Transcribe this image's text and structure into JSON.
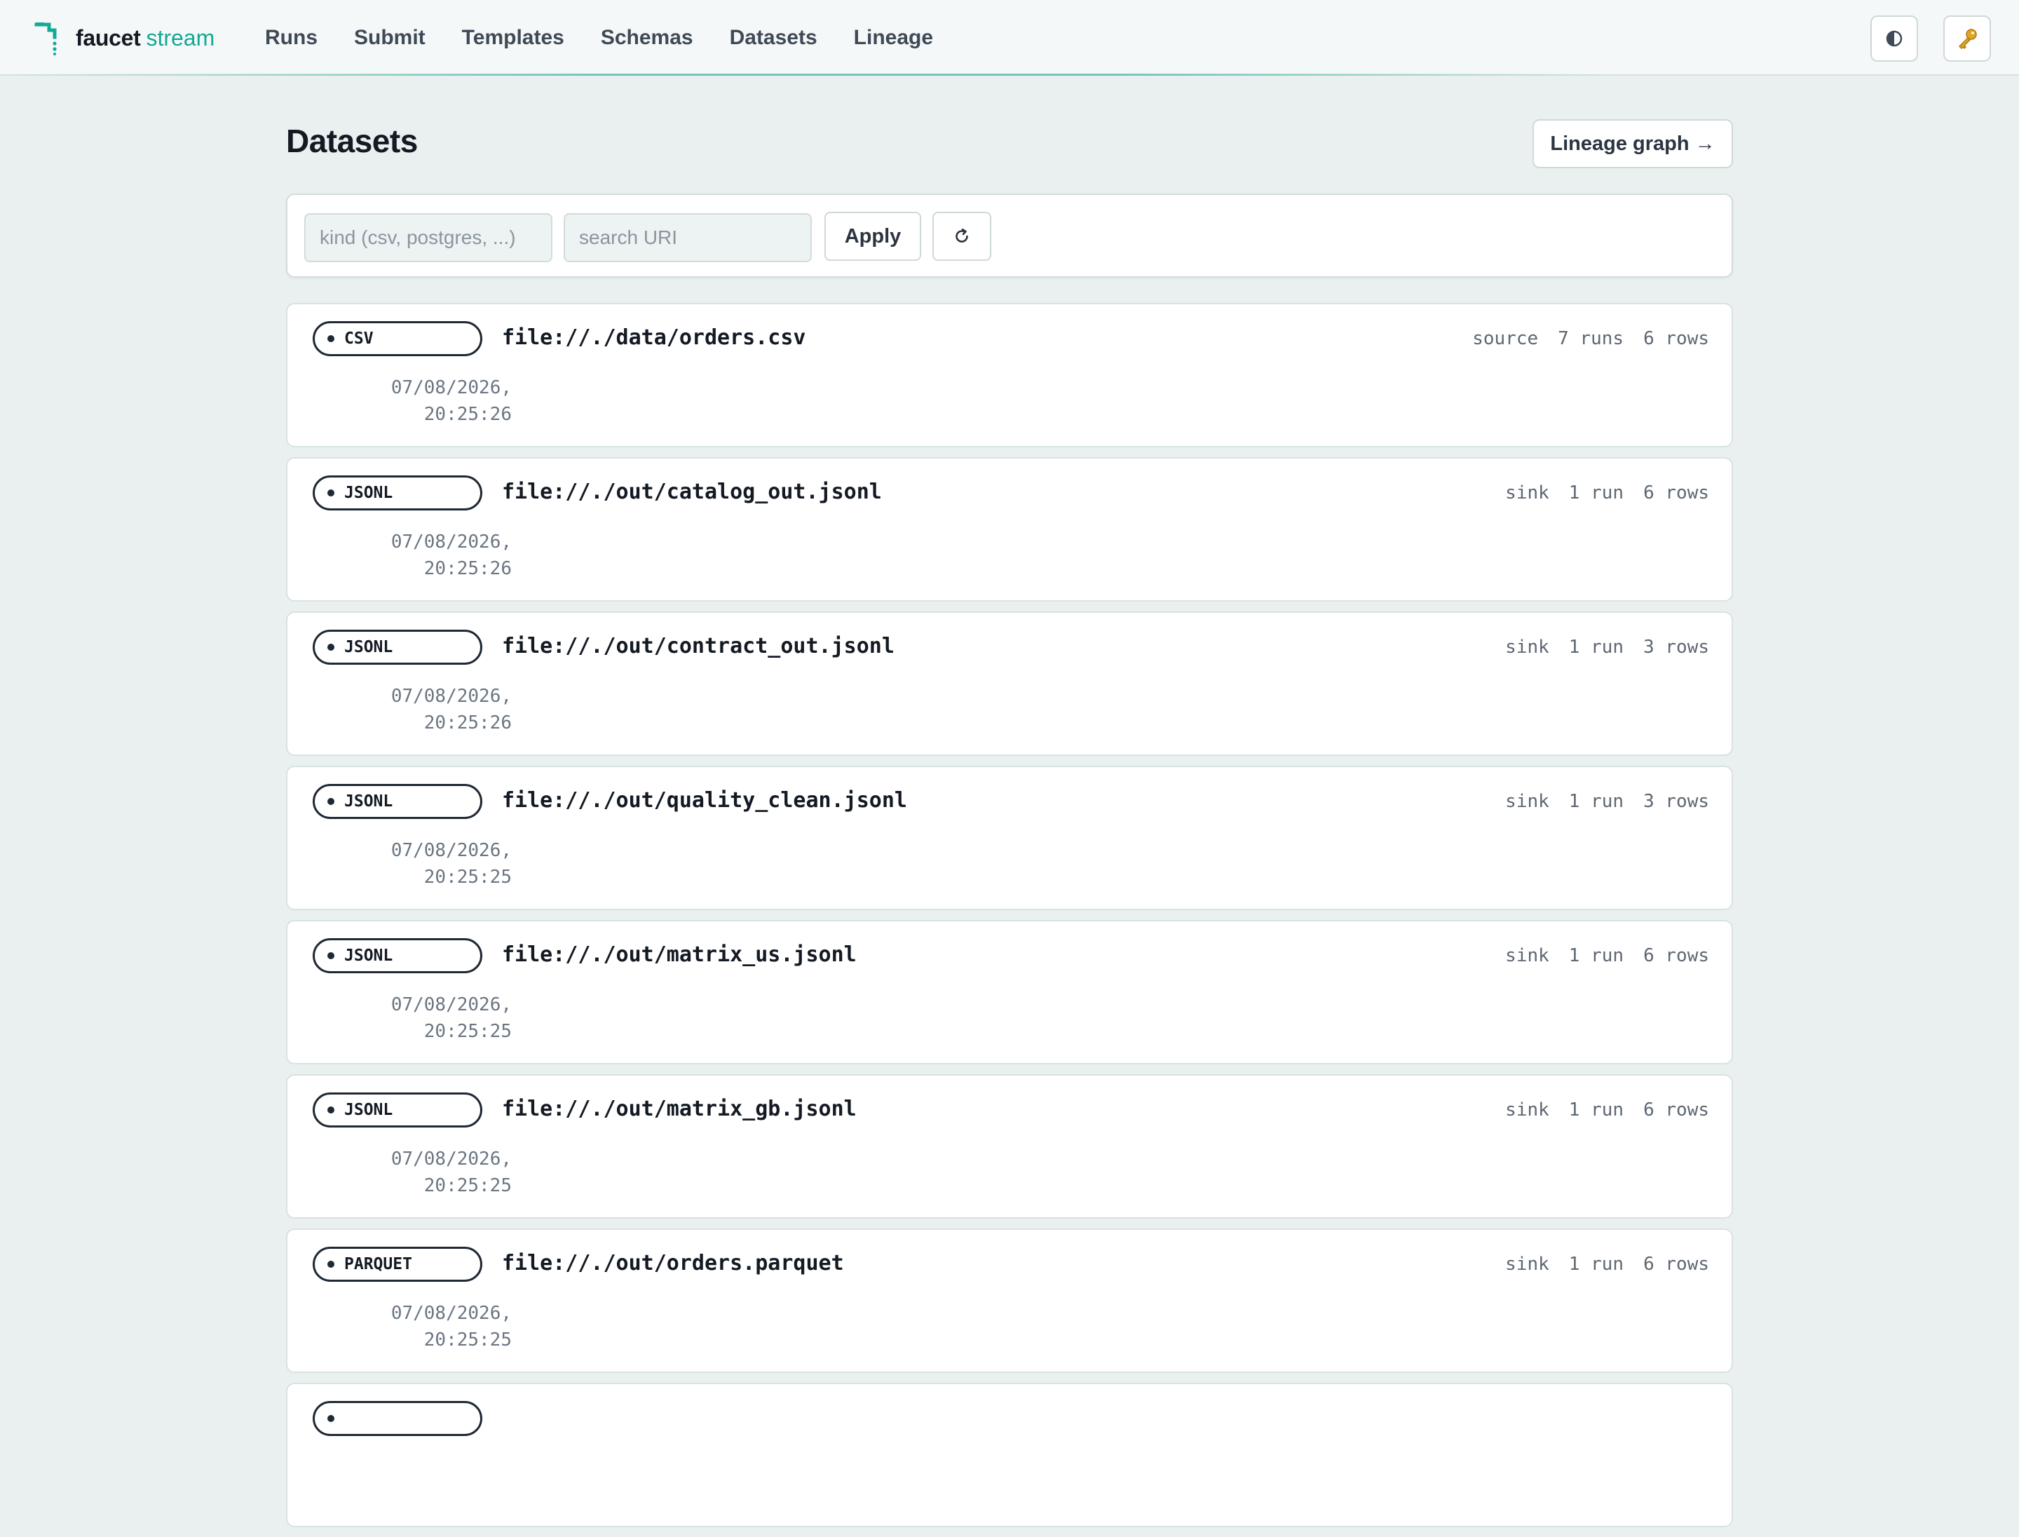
{
  "app": {
    "brand_name": "faucet",
    "brand_accent": "stream"
  },
  "nav": {
    "items": [
      "Runs",
      "Submit",
      "Templates",
      "Schemas",
      "Datasets",
      "Lineage"
    ]
  },
  "header_actions": {
    "theme_icon": "contrast-icon",
    "key_icon": "key-icon"
  },
  "page": {
    "title": "Datasets",
    "lineage_button": "Lineage graph →"
  },
  "filters": {
    "kind_placeholder": "kind (csv, postgres, ...)",
    "kind_value": "",
    "uri_placeholder": "search URI",
    "uri_value": "",
    "apply_label": "Apply",
    "refresh_icon": "refresh-icon"
  },
  "datasets": [
    {
      "kind": "CSV",
      "uri": "file://./data/orders.csv",
      "role": "source",
      "runs": "7 runs",
      "rows": "6 rows",
      "date": "07/08/2026,",
      "time": "20:25:26"
    },
    {
      "kind": "JSONL",
      "uri": "file://./out/catalog_out.jsonl",
      "role": "sink",
      "runs": "1 run",
      "rows": "6 rows",
      "date": "07/08/2026,",
      "time": "20:25:26"
    },
    {
      "kind": "JSONL",
      "uri": "file://./out/contract_out.jsonl",
      "role": "sink",
      "runs": "1 run",
      "rows": "3 rows",
      "date": "07/08/2026,",
      "time": "20:25:26"
    },
    {
      "kind": "JSONL",
      "uri": "file://./out/quality_clean.jsonl",
      "role": "sink",
      "runs": "1 run",
      "rows": "3 rows",
      "date": "07/08/2026,",
      "time": "20:25:25"
    },
    {
      "kind": "JSONL",
      "uri": "file://./out/matrix_us.jsonl",
      "role": "sink",
      "runs": "1 run",
      "rows": "6 rows",
      "date": "07/08/2026,",
      "time": "20:25:25"
    },
    {
      "kind": "JSONL",
      "uri": "file://./out/matrix_gb.jsonl",
      "role": "sink",
      "runs": "1 run",
      "rows": "6 rows",
      "date": "07/08/2026,",
      "time": "20:25:25"
    },
    {
      "kind": "PARQUET",
      "uri": "file://./out/orders.parquet",
      "role": "sink",
      "runs": "1 run",
      "rows": "6 rows",
      "date": "07/08/2026,",
      "time": "20:25:25"
    },
    {
      "kind": "",
      "uri": "",
      "role": "",
      "runs": "",
      "rows": "",
      "date": "",
      "time": ""
    }
  ],
  "colors": {
    "accent": "#14a896",
    "background": "#eaf0f0",
    "text": "#141a24"
  }
}
